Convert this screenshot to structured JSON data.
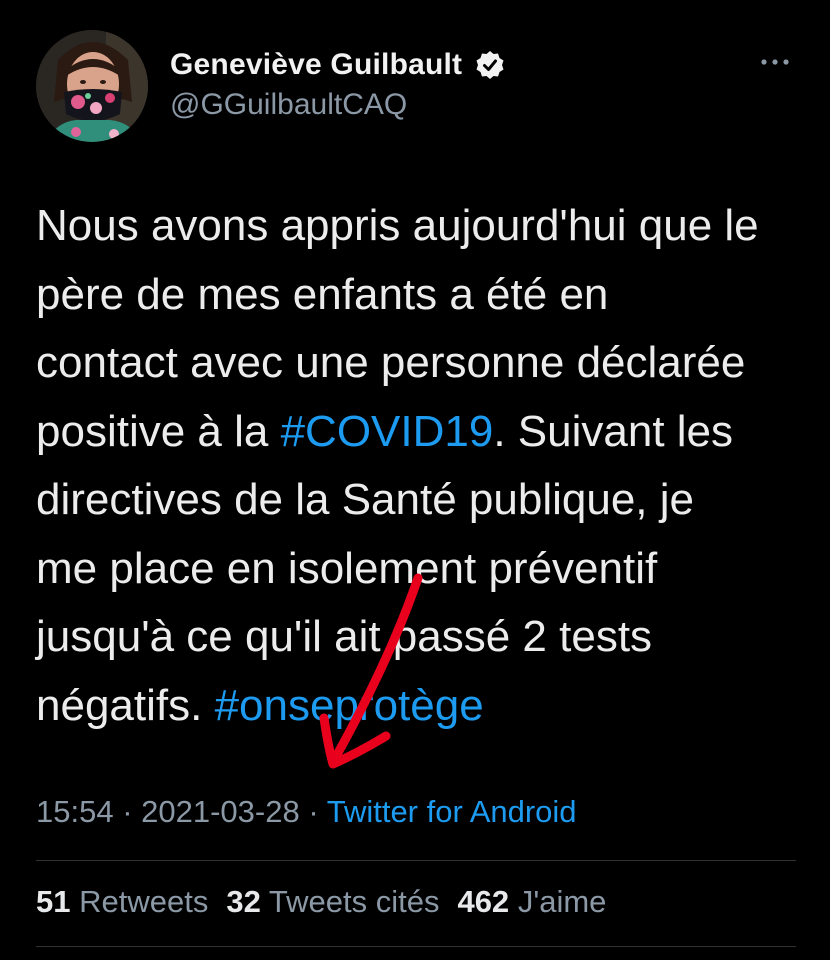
{
  "author": {
    "display_name": "Geneviève Guilbault",
    "handle": "@GGuilbaultCAQ",
    "avatar_icon": "profile-photo",
    "verified_icon": "verified-badge-icon"
  },
  "menu": {
    "more_icon": "more-options-icon"
  },
  "tweet": {
    "lines": [
      "Nous avons appris aujourd'hui que le",
      "père de mes enfants a été en",
      "contact avec une personne déclarée"
    ],
    "line4_before": "positive à la ",
    "hashtag1": "#COVID19",
    "line4_after": ". Suivant les",
    "lines_after": [
      "directives de la Santé publique, je",
      "me place en isolement préventif",
      "jusqu'à ce qu'il ait passé 2 tests"
    ],
    "line8_before": "négatifs. ",
    "hashtag2": "#onseprotège"
  },
  "meta": {
    "time": "15:54",
    "separator": " · ",
    "date": "2021-03-28",
    "source": "Twitter for Android"
  },
  "stats": {
    "retweets_count": "51",
    "retweets_label": "Retweets",
    "quotes_count": "32",
    "quotes_label": "Tweets cités",
    "likes_count": "462",
    "likes_label": "J'aime"
  },
  "colors": {
    "background": "#000000",
    "link": "#1d9bf0",
    "secondary_text": "#8b98a5",
    "annotation": "#e8001c"
  }
}
